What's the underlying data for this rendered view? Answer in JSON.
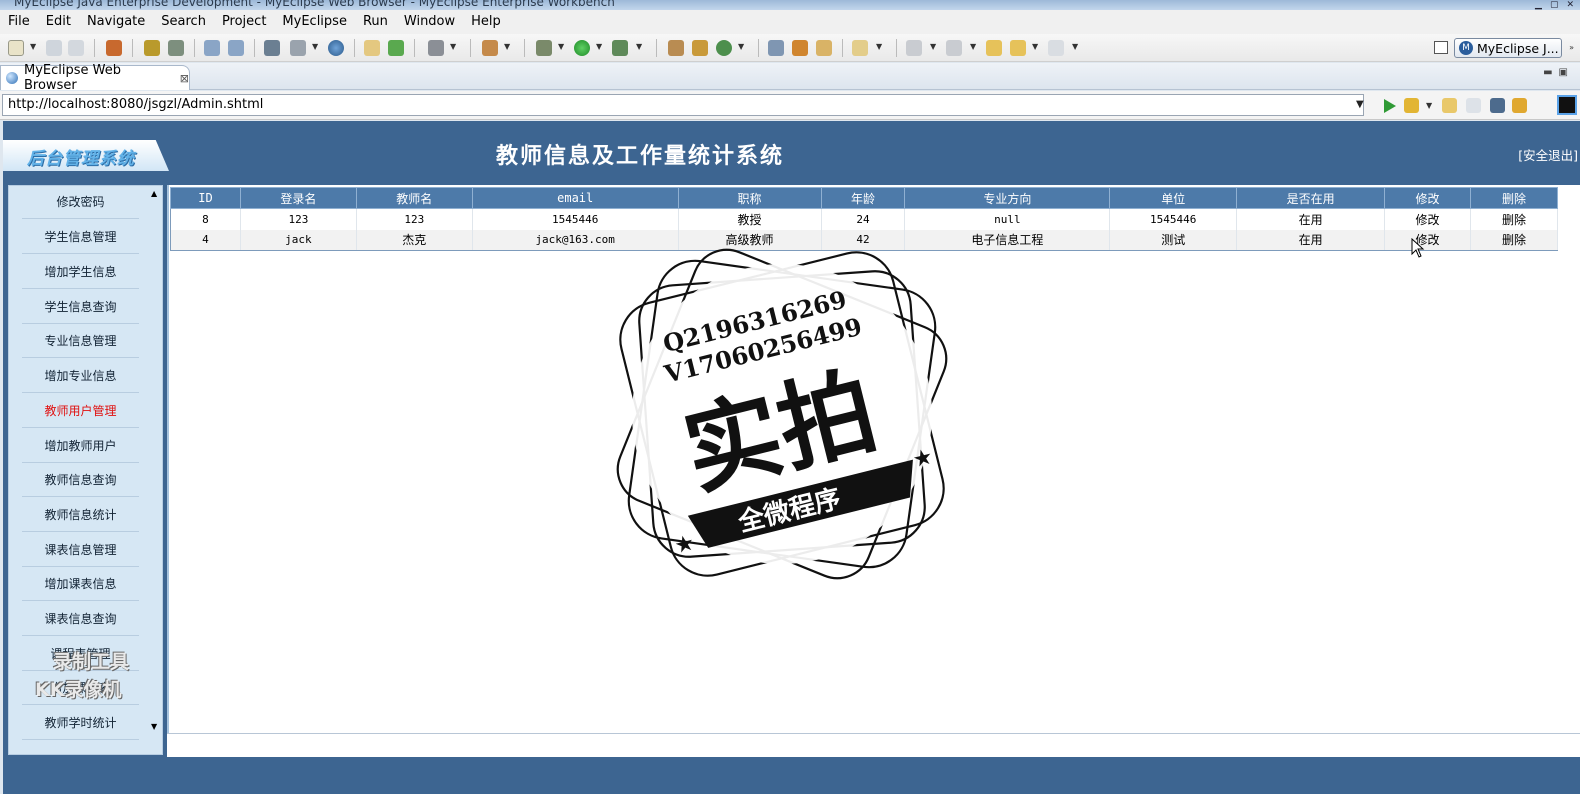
{
  "window": {
    "title": "MyEclipse Java Enterprise Development - MyEclipse Web Browser - MyEclipse Enterprise Workbench"
  },
  "menubar": [
    "File",
    "Edit",
    "Navigate",
    "Search",
    "Project",
    "MyEclipse",
    "Run",
    "Window",
    "Help"
  ],
  "toolbar": {
    "perspective_label": "MyEclipse J..."
  },
  "editor_tab": {
    "label": "MyEclipse Web Browser"
  },
  "address_bar": {
    "url": "http://localhost:8080/jsgzl/Admin.shtml"
  },
  "page": {
    "brand": "后台管理系统",
    "title": "教师信息及工作量统计系统",
    "logout": "[安全退出]",
    "sidebar": [
      "修改密码",
      "学生信息管理",
      "增加学生信息",
      "学生信息查询",
      "专业信息管理",
      "增加专业信息",
      "教师用户管理",
      "增加教师用户",
      "教师信息查询",
      "教师信息统计",
      "课表信息管理",
      "增加课表信息",
      "课表信息查询",
      "课程表管理",
      "增加课程表",
      "教师学时统计"
    ],
    "active_sidebar": "教师用户管理",
    "table": {
      "headers": [
        "ID",
        "登录名",
        "教师名",
        "email",
        "职称",
        "年龄",
        "专业方向",
        "单位",
        "是否在用",
        "修改",
        "删除"
      ],
      "rows": [
        [
          "8",
          "123",
          "123",
          "1545446",
          "教授",
          "24",
          "null",
          "1545446",
          "在用",
          "修改",
          "删除"
        ],
        [
          "4",
          "jack",
          "杰克",
          "jack@163.com",
          "高级教师",
          "42",
          "电子信息工程",
          "测试",
          "在用",
          "修改",
          "删除"
        ]
      ]
    }
  },
  "watermarks": {
    "stamp_line1": "Q2196316269",
    "stamp_line2": "V17060256499",
    "stamp_main": "实拍",
    "stamp_banner": "全微程序",
    "recorder_line1": "录制工具",
    "recorder_line2": "KK录像机"
  },
  "colors": {
    "page_blue": "#3d6591",
    "header_row": "#4d7aa9",
    "sidebar_bg": "#d6e7f4",
    "active_link": "#e01010"
  }
}
